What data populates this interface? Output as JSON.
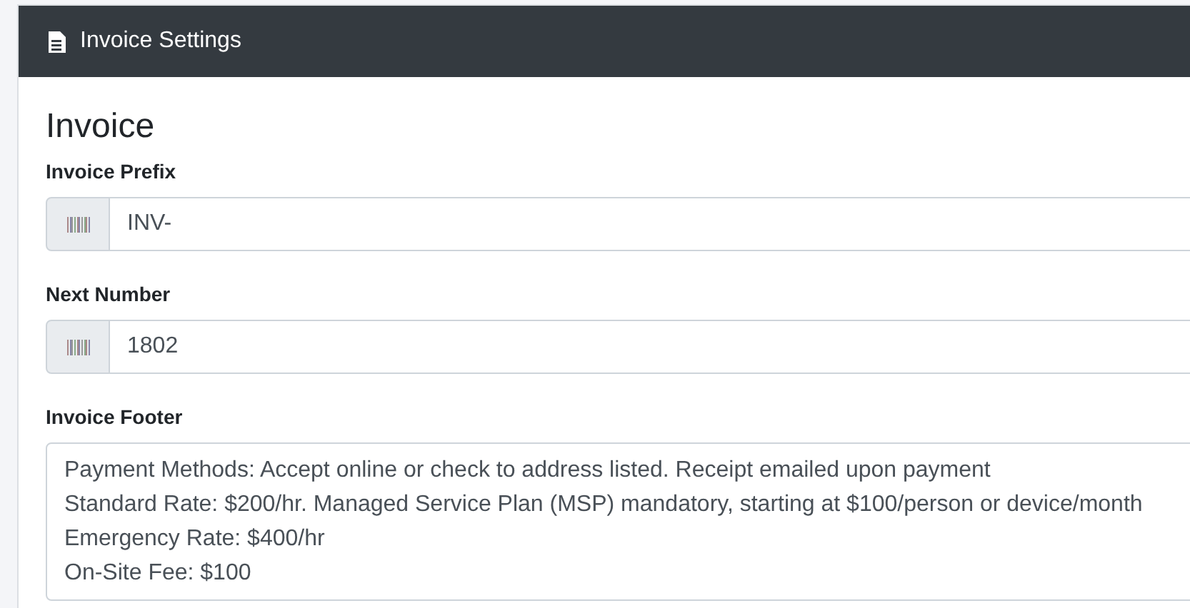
{
  "card": {
    "title": "Invoice Settings"
  },
  "section": {
    "heading": "Invoice"
  },
  "fields": [
    {
      "kind": "input",
      "label": "Invoice Prefix",
      "value": "INV-"
    },
    {
      "kind": "input",
      "label": "Next Number",
      "value": "1802"
    },
    {
      "kind": "textarea",
      "label": "Invoice Footer",
      "lines": [
        "Payment Methods: Accept online or check to address listed. Receipt emailed upon payment",
        "Standard Rate: $200/hr. Managed Service Plan (MSP) mandatory, starting at $100/person or device/month",
        "Emergency Rate: $400/hr",
        "On-Site Fee: $100"
      ]
    }
  ]
}
